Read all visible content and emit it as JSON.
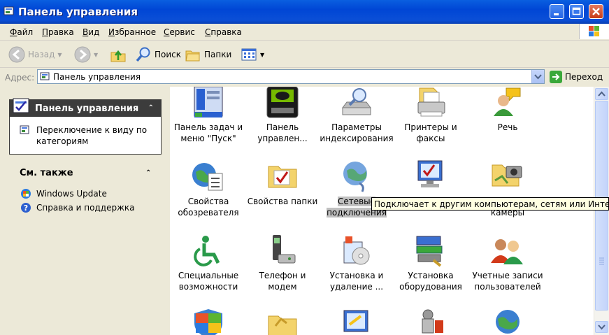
{
  "window": {
    "title": "Панель управления"
  },
  "menu": [
    "Файл",
    "Правка",
    "Вид",
    "Избранное",
    "Сервис",
    "Справка"
  ],
  "toolbar": {
    "back": "Назад",
    "search": "Поиск",
    "folders": "Папки"
  },
  "address": {
    "label": "Адрес:",
    "value": "Панель управления",
    "go": "Переход"
  },
  "sidebar": {
    "panel_title": "Панель управления",
    "switch_link": "Переключение к виду по категориям",
    "see_also": "См. также",
    "links": [
      "Windows Update",
      "Справка и поддержка"
    ]
  },
  "items": [
    {
      "l1": "Панель задач и",
      "l2": "меню \"Пуск\""
    },
    {
      "l1": "Панель",
      "l2": "управлен..."
    },
    {
      "l1": "Параметры",
      "l2": "индексирования"
    },
    {
      "l1": "Принтеры и",
      "l2": "факсы"
    },
    {
      "l1": "Речь",
      "l2": ""
    },
    {
      "l1": "Свойства",
      "l2": "обозревателя"
    },
    {
      "l1": "Свойства папки",
      "l2": ""
    },
    {
      "l1": "Сетевые",
      "l2": "подключения"
    },
    {
      "l1": "",
      "l2": ""
    },
    {
      "l1": "",
      "l2": "камеры"
    },
    {
      "l1": "Специальные",
      "l2": "возможности"
    },
    {
      "l1": "Телефон и",
      "l2": "модем"
    },
    {
      "l1": "Установка и",
      "l2": "удаление ..."
    },
    {
      "l1": "Установка",
      "l2": "оборудования"
    },
    {
      "l1": "Учетные записи",
      "l2": "пользователей"
    }
  ],
  "tooltip": "Подключает к другим компьютерам, сетям или Интернету"
}
